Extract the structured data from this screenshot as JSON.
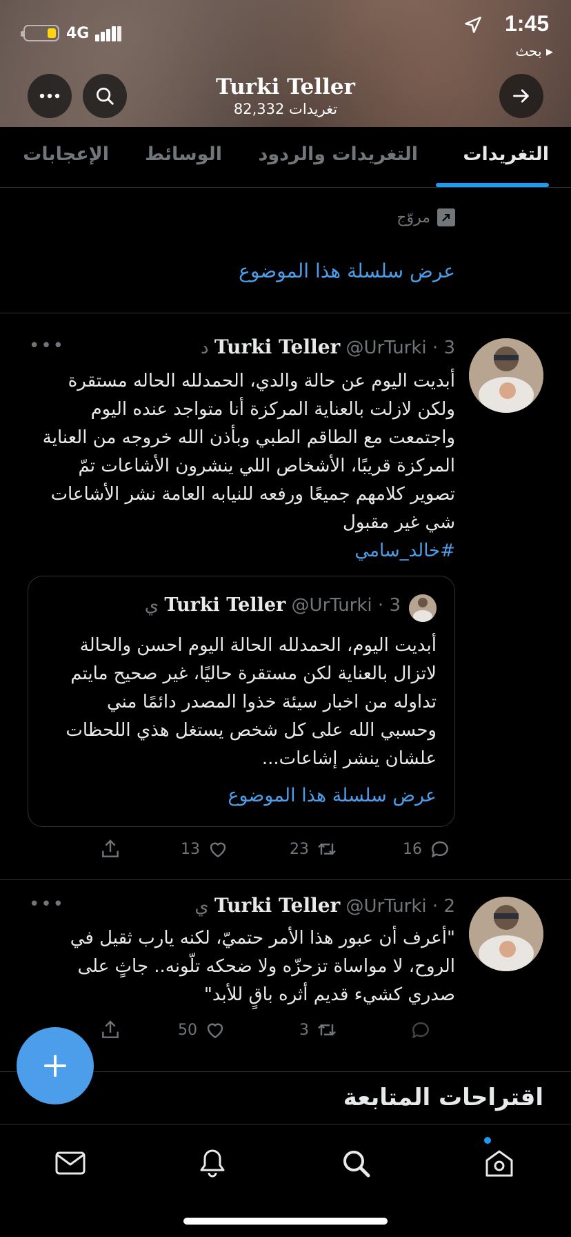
{
  "status_bar": {
    "time": "1:45",
    "network": "4G",
    "back_label": "بحث ▸"
  },
  "header": {
    "name": "Turki Teller",
    "tweet_count": "82,332 تغريدات"
  },
  "tabs": [
    {
      "label": "التغريدات",
      "active": true
    },
    {
      "label": "التغريدات والردود",
      "active": false
    },
    {
      "label": "الوسائط",
      "active": false
    },
    {
      "label": "الإعجابات",
      "active": false
    }
  ],
  "prev_tweet": {
    "promoted_label": "مروّج",
    "thread_link": "عرض سلسلة هذا الموضوع"
  },
  "tweets": [
    {
      "name": "Turki Teller",
      "handle": "@UrTurki",
      "time": "· 3 د",
      "more": "•••",
      "body": "أبديت اليوم عن حالة والدي، الحمدلله الحاله مستقرة ولكن لازلت بالعناية المركزة أنا متواجد عنده اليوم واجتمعت مع الطاقم الطبي وبأذن الله خروجه من العناية المركزة قريبًا، الأشخاص اللي ينشرون الأشاعات تمّ تصوير كلامهم جميعًا ورفعه للنيابه العامة نشر الأشاعات شي غير مقبول",
      "hashtag": "#خالد_سامي",
      "quote": {
        "name": "Turki Teller",
        "handle": "@UrTurki",
        "time": "· 3 ي",
        "body": "أبديت اليوم، الحمدلله الحالة اليوم احسن والحالة لاتزال بالعناية لكن مستقرة حاليًا، غير صحيح مايتم تداوله من اخبار سيئة خذوا المصدر دائمًا مني وحسبي الله على كل شخص يستغل هذي اللحظات علشان ينشر إشاعات...",
        "thread_link": "عرض سلسلة هذا الموضوع"
      },
      "replies": "16",
      "retweets": "23",
      "likes": "13"
    },
    {
      "name": "Turki Teller",
      "handle": "@UrTurki",
      "time": "· 2 ي",
      "more": "•••",
      "body": "\"أعرف أن عبور هذا الأمر حتميّ، لكنه يارب ثقيل في الروح، لا مواساة تزحزّه ولا ضحكه تلّونه.. جاثٍ على صدري كشيء قديم أثره باقٍ للأبد\"",
      "replies": "",
      "retweets": "3",
      "likes": "50"
    }
  ],
  "who_to_follow": "اقتراحات المتابعة",
  "icons": {
    "more": "more-dots-icon",
    "search": "search-icon",
    "forward": "arrow-right-icon",
    "compose": "plus-icon",
    "messages": "mail-icon",
    "notifications": "bell-icon",
    "explore": "search-icon",
    "home": "home-icon"
  },
  "colors": {
    "accent": "#1d9bf0",
    "link": "#4c9eeb",
    "muted": "#71767b"
  }
}
